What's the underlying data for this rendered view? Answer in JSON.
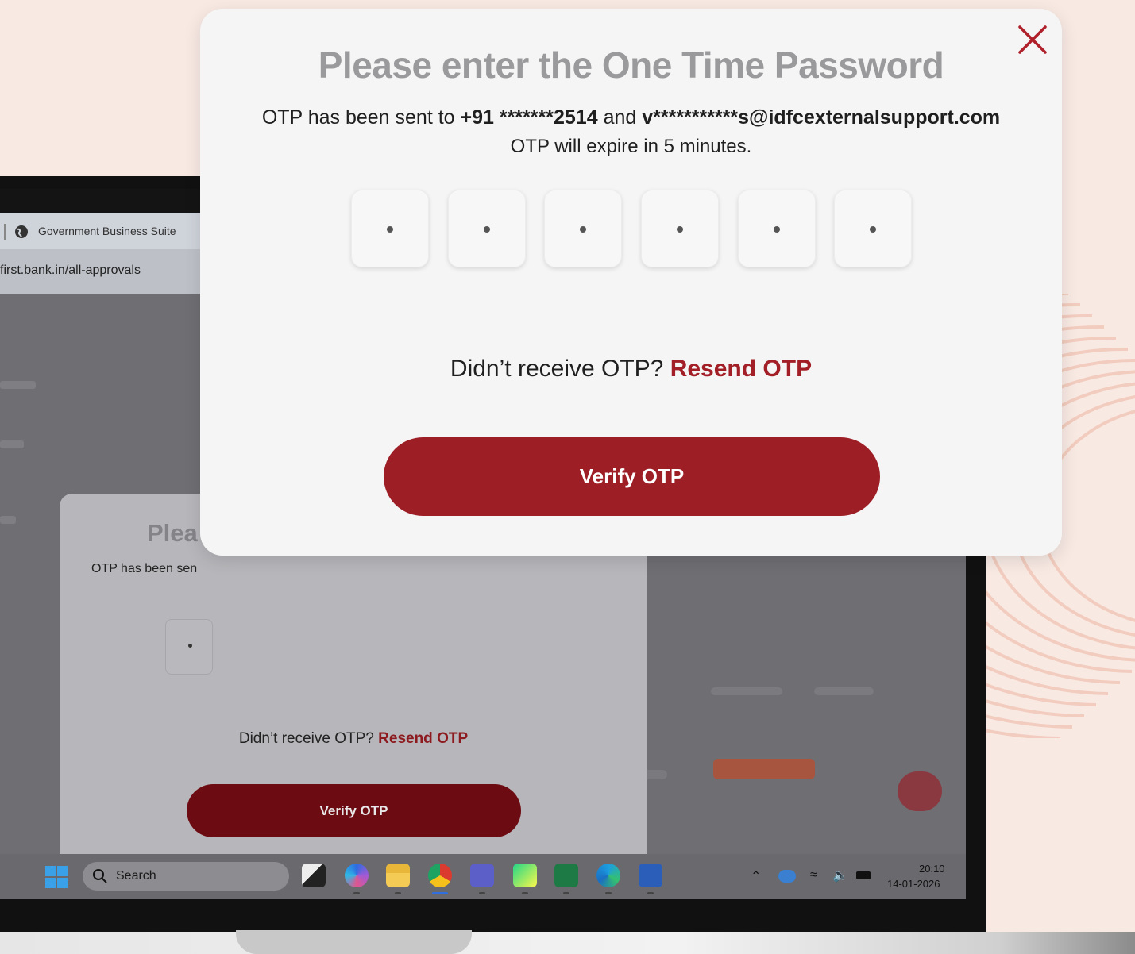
{
  "browser": {
    "tab_title": "Government Business Suite",
    "url": "first.bank.in/all-approvals"
  },
  "background_modal": {
    "title_partial": "Plea",
    "sent_partial": "OTP has been sen",
    "resend_prefix": "Didn’t receive OTP?",
    "resend_link": "Resend OTP",
    "verify_label": "Verify OTP"
  },
  "otp_modal": {
    "title": "Please enter the One Time Password",
    "sent_prefix": "OTP has been sent to",
    "phone_masked": "+91 *******2514",
    "conjunction": "and",
    "email_masked": "v***********s@idfcexternalsupport.com",
    "expiry_text": "OTP will expire in 5 minutes.",
    "otp_digits": [
      "•",
      "•",
      "•",
      "•",
      "•",
      "•"
    ],
    "resend_prefix": "Didn’t receive OTP?",
    "resend_link": "Resend OTP",
    "verify_label": "Verify OTP",
    "accent_color": "#9e1e26"
  },
  "taskbar": {
    "search_label": "Search",
    "apps": [
      "task-view-icon",
      "copilot-icon",
      "file-explorer-icon",
      "chrome-icon",
      "teams-icon",
      "pycharm-icon",
      "excel-icon",
      "edge-icon",
      "word-icon"
    ],
    "time": "20:10",
    "date": "14-01-2026"
  }
}
